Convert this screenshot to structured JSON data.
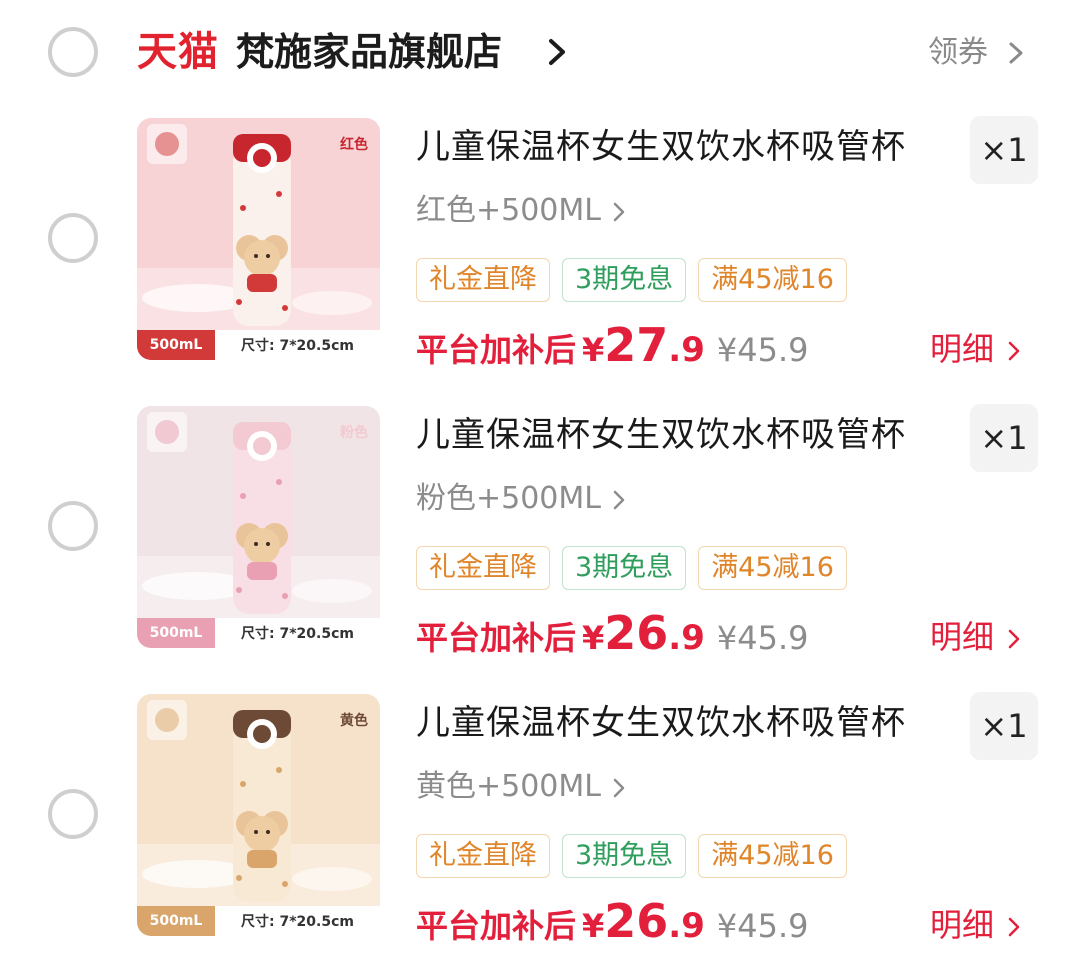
{
  "store": {
    "logo": "天猫",
    "name": "梵施家品旗舰店",
    "coupon": "领券"
  },
  "items": [
    {
      "title": "儿童保温杯女生双饮水杯吸管杯",
      "sku": "红色+500ML",
      "quantity": "×1",
      "badges": [
        "礼金直降",
        "3期免息",
        "满45减16"
      ],
      "price_label": "平台加补后",
      "currency": "¥",
      "price_int": "27",
      "price_dec": ".9",
      "original_price": "¥45.9",
      "detail": "明细",
      "thumb_tag": "红色",
      "thumb_volume": "500mL",
      "thumb_size": "尺寸: 7*20.5cm",
      "theme": {
        "bg": "#f7d3d6",
        "cap": "#c8262e",
        "body": "#fbf1ec",
        "accent": "#d23a3a"
      }
    },
    {
      "title": "儿童保温杯女生双饮水杯吸管杯",
      "sku": "粉色+500ML",
      "quantity": "×1",
      "badges": [
        "礼金直降",
        "3期免息",
        "满45减16"
      ],
      "price_label": "平台加补后",
      "currency": "¥",
      "price_int": "26",
      "price_dec": ".9",
      "original_price": "¥45.9",
      "detail": "明细",
      "thumb_tag": "粉色",
      "thumb_volume": "500mL",
      "thumb_size": "尺寸: 7*20.5cm",
      "theme": {
        "bg": "#f1e4e6",
        "cap": "#f3c9d2",
        "body": "#f8dfe5",
        "accent": "#e9a0b2"
      }
    },
    {
      "title": "儿童保温杯女生双饮水杯吸管杯",
      "sku": "黄色+500ML",
      "quantity": "×1",
      "badges": [
        "礼金直降",
        "3期免息",
        "满45减16"
      ],
      "price_label": "平台加补后",
      "currency": "¥",
      "price_int": "26",
      "price_dec": ".9",
      "original_price": "¥45.9",
      "detail": "明细",
      "thumb_tag": "黄色",
      "thumb_volume": "500mL",
      "thumb_size": "尺寸: 7*20.5cm",
      "theme": {
        "bg": "#f6e2cb",
        "cap": "#6d4a36",
        "body": "#f8e9d4",
        "accent": "#d9a56a"
      }
    }
  ]
}
